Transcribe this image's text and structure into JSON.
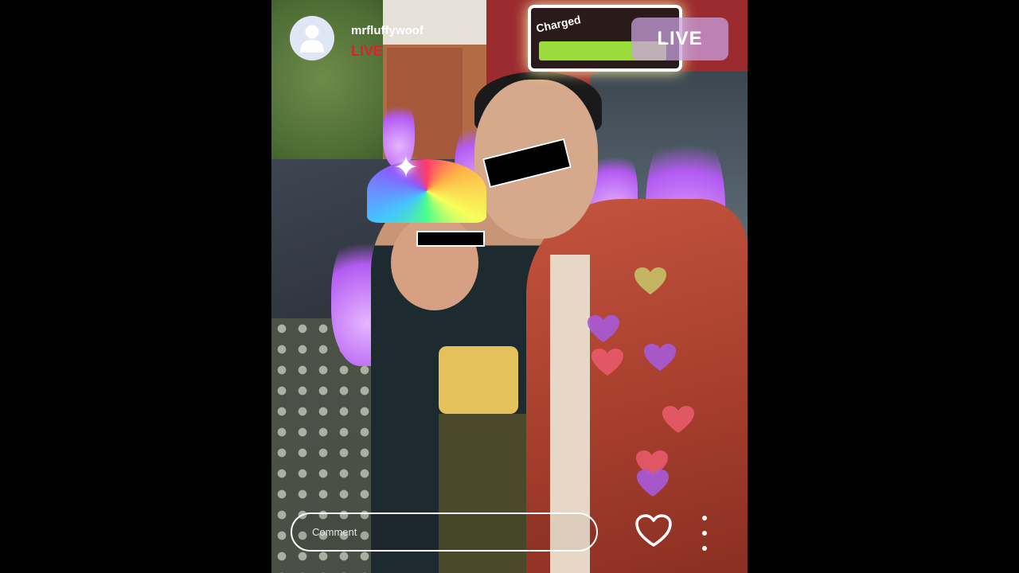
{
  "header": {
    "username": "mrfluffywoof",
    "live_label": "LIVE",
    "live_badge": "LIVE",
    "avatar_icon": "user-silhouette-icon"
  },
  "overlay": {
    "battery_label": "Charged",
    "battery_level": 1.0
  },
  "footer": {
    "comment_placeholder": "Comment",
    "like_icon": "heart-outline-icon",
    "more_icon": "vertical-ellipsis-icon"
  },
  "colors": {
    "live_red": "#e2202a",
    "badge_bg": "#c8a0dc",
    "flame": "#b35bf2"
  }
}
